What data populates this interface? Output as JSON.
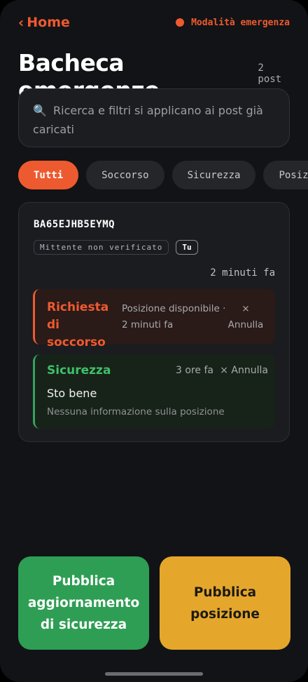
{
  "header": {
    "back_chevron": "‹",
    "back_label": "Home",
    "mode_label": "Modalità emergenza",
    "accent_color": "#ee5a2f"
  },
  "page": {
    "title": "Bacheca emergenze",
    "post_count": "2 post"
  },
  "search": {
    "icon": "🔍",
    "placeholder": "Ricerca e filtri si applicano ai post già caricati"
  },
  "filters": [
    "Tutti",
    "Soccorso",
    "Sicurezza",
    "Posizione"
  ],
  "post": {
    "sender_id": "BA65EJHB5EYMQ",
    "unverified_badge": "Mittente non verificato",
    "you_badge": "Tu",
    "timestamp": "2 minuti fa",
    "entries": [
      {
        "title": "Richiesta di soccorso",
        "meta": "Posizione disponibile · 2 minuti fa",
        "cancel": "× Annulla",
        "color": "#ee5a2f"
      },
      {
        "title": "Sicurezza",
        "time": "3 ore fa",
        "cancel": "× Annulla",
        "status": "Sto bene",
        "location": "Nessuna informazione sulla posizione",
        "color": "#3ec06a"
      }
    ]
  },
  "actions": {
    "safety_label": "Pubblica aggiornamento di sicurezza",
    "position_label": "Pubblica posizione",
    "safety_color": "#2e9e54",
    "position_color": "#e5a72b"
  }
}
